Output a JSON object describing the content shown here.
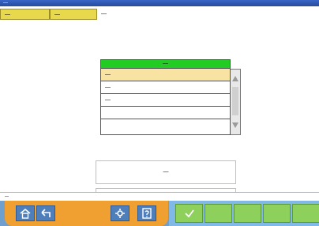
{
  "window": {
    "title": "—"
  },
  "tabs": [
    {
      "label": "—"
    },
    {
      "label": "—"
    },
    {
      "label": "—"
    }
  ],
  "list": {
    "header": "—",
    "items": [
      {
        "label": "—",
        "selected": true
      },
      {
        "label": "—",
        "selected": false
      },
      {
        "label": "—",
        "selected": false
      },
      {
        "label": "",
        "selected": false
      },
      {
        "label": "",
        "selected": false
      }
    ]
  },
  "message": "—",
  "status": "",
  "info_bar": "—",
  "toolbar": {
    "left_icons": [
      "home-icon",
      "back-arrow-icon",
      "settings-icon",
      "help-icon"
    ],
    "right_icons": [
      "checkmark-icon"
    ]
  },
  "colors": {
    "list_header": "#22cc22",
    "selected_row": "#f9e3a3",
    "tab": "#e7d84c",
    "toolbar_left": "#f0a030",
    "toolbar_right": "#8ed05c",
    "toolbar_bg": "#6f9fce"
  }
}
